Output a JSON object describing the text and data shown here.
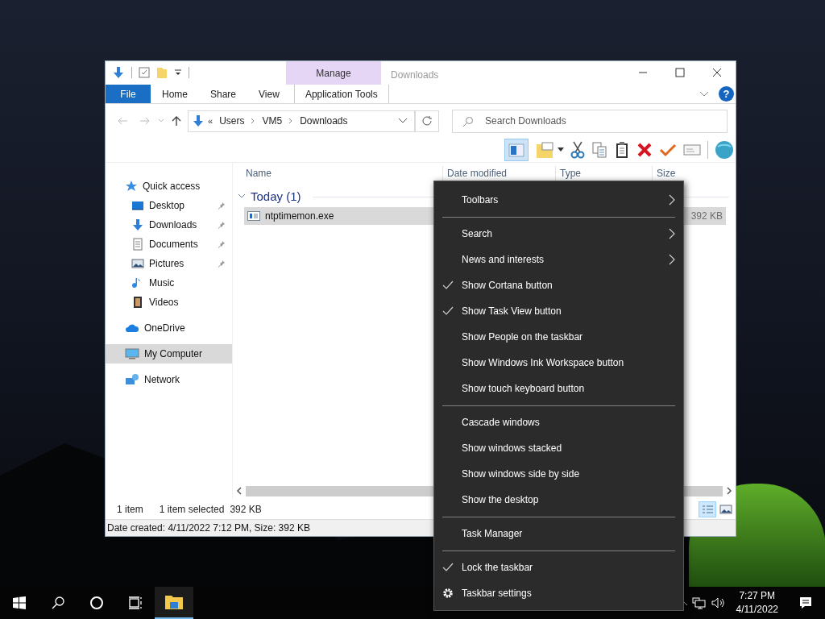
{
  "explorer": {
    "title": "Downloads",
    "context_group": "Manage",
    "ribbon_tabs": [
      {
        "label": "File",
        "kind": "file"
      },
      {
        "label": "Home",
        "kind": "tab"
      },
      {
        "label": "Share",
        "kind": "tab"
      },
      {
        "label": "View",
        "kind": "tab"
      },
      {
        "label": "Application Tools",
        "kind": "context"
      }
    ],
    "address": {
      "prefix": "«",
      "path": [
        "Users",
        "VM5",
        "Downloads"
      ]
    },
    "search": {
      "placeholder": "Search Downloads"
    },
    "help": "?",
    "nav": [
      {
        "label": "Quick access",
        "selected": false,
        "children": [
          {
            "label": "Desktop",
            "pinned": true,
            "selected": false
          },
          {
            "label": "Downloads",
            "pinned": true,
            "selected": false
          },
          {
            "label": "Documents",
            "pinned": true,
            "selected": false
          },
          {
            "label": "Pictures",
            "pinned": true,
            "selected": false
          },
          {
            "label": "Music",
            "pinned": false,
            "selected": false
          },
          {
            "label": "Videos",
            "pinned": false,
            "selected": false
          }
        ]
      },
      {
        "label": "OneDrive",
        "selected": false
      },
      {
        "label": "My Computer",
        "selected": true
      },
      {
        "label": "Network",
        "selected": false
      }
    ],
    "columns": [
      "Name",
      "Date modified",
      "Type",
      "Size"
    ],
    "group": "Today (1)",
    "files": [
      {
        "name": "ntptimemon.exe",
        "size": "392 KB",
        "selected": true
      }
    ],
    "status": {
      "count": "1 item",
      "selection": "1 item selected",
      "size": "392 KB"
    },
    "details": "Date created: 4/11/2022 7:12 PM, Size: 392 KB"
  },
  "context_menu": [
    {
      "kind": "item",
      "label": "Toolbars",
      "submenu": true,
      "checked": false
    },
    {
      "kind": "separator"
    },
    {
      "kind": "item",
      "label": "Search",
      "submenu": true,
      "checked": false
    },
    {
      "kind": "item",
      "label": "News and interests",
      "submenu": true,
      "checked": false
    },
    {
      "kind": "item",
      "label": "Show Cortana button",
      "submenu": false,
      "checked": true
    },
    {
      "kind": "item",
      "label": "Show Task View button",
      "submenu": false,
      "checked": true
    },
    {
      "kind": "item",
      "label": "Show People on the taskbar",
      "submenu": false,
      "checked": false
    },
    {
      "kind": "item",
      "label": "Show Windows Ink Workspace button",
      "submenu": false,
      "checked": false
    },
    {
      "kind": "item",
      "label": "Show touch keyboard button",
      "submenu": false,
      "checked": false
    },
    {
      "kind": "separator"
    },
    {
      "kind": "item",
      "label": "Cascade windows",
      "submenu": false,
      "checked": false
    },
    {
      "kind": "item",
      "label": "Show windows stacked",
      "submenu": false,
      "checked": false
    },
    {
      "kind": "item",
      "label": "Show windows side by side",
      "submenu": false,
      "checked": false
    },
    {
      "kind": "item",
      "label": "Show the desktop",
      "submenu": false,
      "checked": false
    },
    {
      "kind": "separator"
    },
    {
      "kind": "item",
      "label": "Task Manager",
      "submenu": false,
      "checked": false
    },
    {
      "kind": "separator"
    },
    {
      "kind": "item",
      "label": "Lock the taskbar",
      "submenu": false,
      "checked": true
    },
    {
      "kind": "settings",
      "label": "Taskbar settings",
      "submenu": false
    }
  ],
  "taskbar": {
    "time": "7:27 PM",
    "date": "4/11/2022"
  }
}
